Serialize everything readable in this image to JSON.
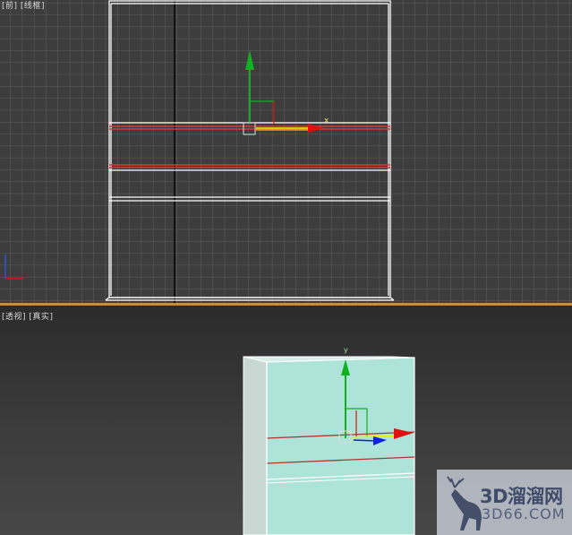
{
  "viewports": {
    "front": {
      "label_parts": [
        "[",
        "前",
        "] [",
        "线框",
        "]"
      ]
    },
    "perspective": {
      "label_parts": [
        "[",
        "透视",
        "] [",
        "真实",
        "]"
      ]
    }
  },
  "gizmo": {
    "x_axis_label": "x",
    "y_axis_label": "y"
  },
  "watermark": {
    "title": "3D溜溜网",
    "domain": "3D66.COM"
  },
  "colors": {
    "grid": "#5e5e5e",
    "wireframe": "#ffffff",
    "highlight_edge": "#d23c3c",
    "x_axis": "#e01010",
    "y_axis": "#10b020",
    "z_axis": "#1020e0",
    "selection_plane": "#f0f000",
    "object_face": "#aee3da",
    "viewport_border": "#caa24a"
  }
}
